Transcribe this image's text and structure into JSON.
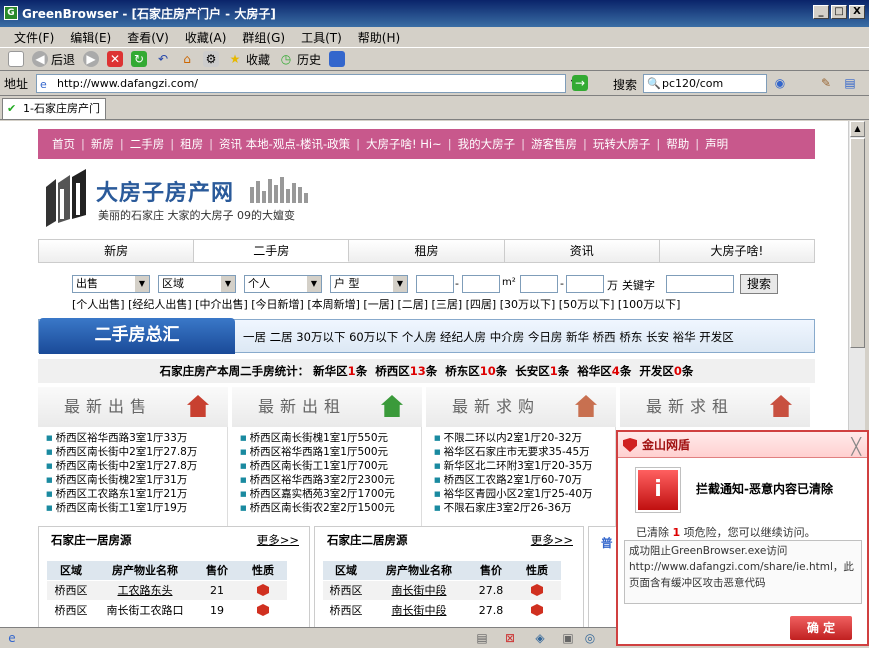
{
  "window": {
    "title": "GreenBrowser - [石家庄房产门户 - 大房子]",
    "min": "_",
    "max": "□",
    "close": "X",
    "app_icon": "G"
  },
  "menu": [
    "文件(F)",
    "编辑(E)",
    "查看(V)",
    "收藏(A)",
    "群组(G)",
    "工具(T)",
    "帮助(H)"
  ],
  "toolbar": {
    "back": "后退",
    "favorites": "收藏",
    "history": "历史"
  },
  "address": {
    "label": "地址",
    "url": "http://www.dafangzi.com/",
    "search_label": "搜索",
    "search_value": "pc120/com"
  },
  "tab": {
    "label": "1-石家庄房产门"
  },
  "site": {
    "nav": [
      "首页",
      "新房",
      "二手房",
      "租房",
      "资讯 本地-观点-楼讯-政策",
      "大房子啥! Hi~",
      "我的大房子",
      "游客售房",
      "玩转大房子",
      "帮助",
      "声明"
    ],
    "logo_title": "大房子房产网",
    "logo_sub": "美丽的石家庄 大家的大房子 09的大嬗变",
    "tabs": [
      "新房",
      "二手房",
      "租房",
      "资讯",
      "大房子啥!"
    ],
    "selects": [
      "出售",
      "区域",
      "个人",
      "户 型"
    ],
    "unit_area": "m²",
    "unit_price": "万",
    "keyword_label": "关键字",
    "search_btn": "搜索",
    "quick_links": "[个人出售] [经纪人出售] [中介出售] [今日新增] [本周新增] [一居] [二居] [三居] [四居] [30万以下] [50万以下] [100万以下]",
    "summary_title": "二手房总汇",
    "summary_links": "一居 二居 30万以下 60万以下 个人房 经纪人房 中介房 今日房 新华 桥西 桥东 长安 裕华 开发区",
    "stats": {
      "prefix": "石家庄房产本周二手房统计：",
      "items": [
        {
          "area": "新华区",
          "n": "1",
          "u": "条"
        },
        {
          "area": "桥西区",
          "n": "13",
          "u": "条"
        },
        {
          "area": "桥东区",
          "n": "10",
          "u": "条"
        },
        {
          "area": "长安区",
          "n": "1",
          "u": "条"
        },
        {
          "area": "裕华区",
          "n": "4",
          "u": "条"
        },
        {
          "area": "开发区",
          "n": "0",
          "u": "条"
        }
      ]
    },
    "columns": [
      {
        "title": "最新出售",
        "items": [
          "桥西区裕华西路3室1厅33万",
          "桥西区南长街中2室1厅27.8万",
          "桥西区南长街中2室1厅27.8万",
          "桥西区南长街槐2室1厅31万",
          "桥西区工农路东1室1厅21万",
          "桥西区南长街工1室1厅19万"
        ]
      },
      {
        "title": "最新出租",
        "items": [
          "桥西区南长街槐1室1厅550元",
          "桥西区裕华西路1室1厅500元",
          "桥西区南长街工1室1厅700元",
          "桥西区裕华西路3室2厅2300元",
          "桥西区嘉实栖苑3室2厅1700元",
          "桥西区南长街农2室2厅1500元"
        ]
      },
      {
        "title": "最新求购",
        "items": [
          "不限二环以内2室1厅20-32万",
          "裕华区石家庄市无要求35-45万",
          "新华区北二环附3室1厅20-35万",
          "桥西区工农路2室1厅60-70万",
          "裕华区青园小区2室1厅25-40万",
          "不限石家庄3室2厅26-36万"
        ]
      },
      {
        "title": "最新求租",
        "items": []
      }
    ],
    "table1": {
      "title": "石家庄一居房源",
      "more": "更多>>",
      "headers": [
        "区域",
        "房产物业名称",
        "售价",
        "性质"
      ],
      "rows": [
        [
          "桥西区",
          "工农路东头",
          "21"
        ],
        [
          "桥西区",
          "南长街工农路口",
          "19"
        ]
      ]
    },
    "table2": {
      "title": "石家庄二居房源",
      "more": "更多>>",
      "headers": [
        "区域",
        "房产物业名称",
        "售价",
        "性质"
      ],
      "rows": [
        [
          "桥西区",
          "南长街中段",
          "27.8"
        ],
        [
          "桥西区",
          "南长街中段",
          "27.8"
        ]
      ]
    },
    "partial": "普"
  },
  "popup": {
    "title": "金山网盾",
    "close": "╳",
    "heading": "拦截通知-恶意内容已清除",
    "info_prefix": "已清除",
    "info_count": "1",
    "info_suffix": "项危险，您可以继续访问。",
    "message": "成功阻止GreenBrowser.exe访问http://www.dafangzi.com/share/ie.html，此页面含有缓冲区攻击恶意代码",
    "ok": "确 定"
  }
}
